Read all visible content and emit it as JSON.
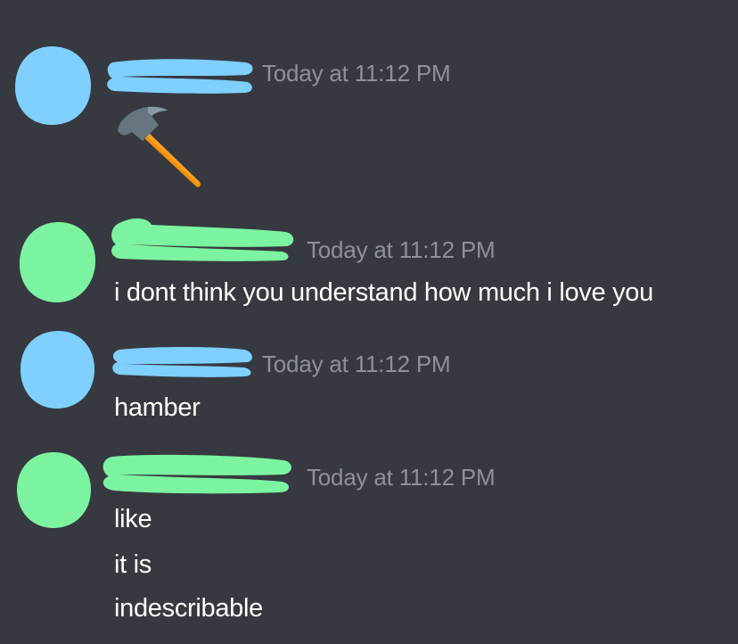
{
  "colors": {
    "background": "#36393f",
    "timestamp": "#8e9297",
    "message_text": "#ffffff",
    "user_blue": "#7fcfff",
    "user_green": "#7cf3a0"
  },
  "messages": [
    {
      "user_color": "user_blue",
      "timestamp": "Today at 11:12 PM",
      "content_emoji": "hammer-icon",
      "lines": []
    },
    {
      "user_color": "user_green",
      "timestamp": "Today at 11:12 PM",
      "lines": [
        "i dont think you understand how much i love you"
      ]
    },
    {
      "user_color": "user_blue",
      "timestamp": "Today at 11:12 PM",
      "lines": [
        "hamber"
      ]
    },
    {
      "user_color": "user_green",
      "timestamp": "Today at 11:12 PM",
      "lines": [
        "like",
        "it is",
        "indescribable"
      ]
    }
  ]
}
